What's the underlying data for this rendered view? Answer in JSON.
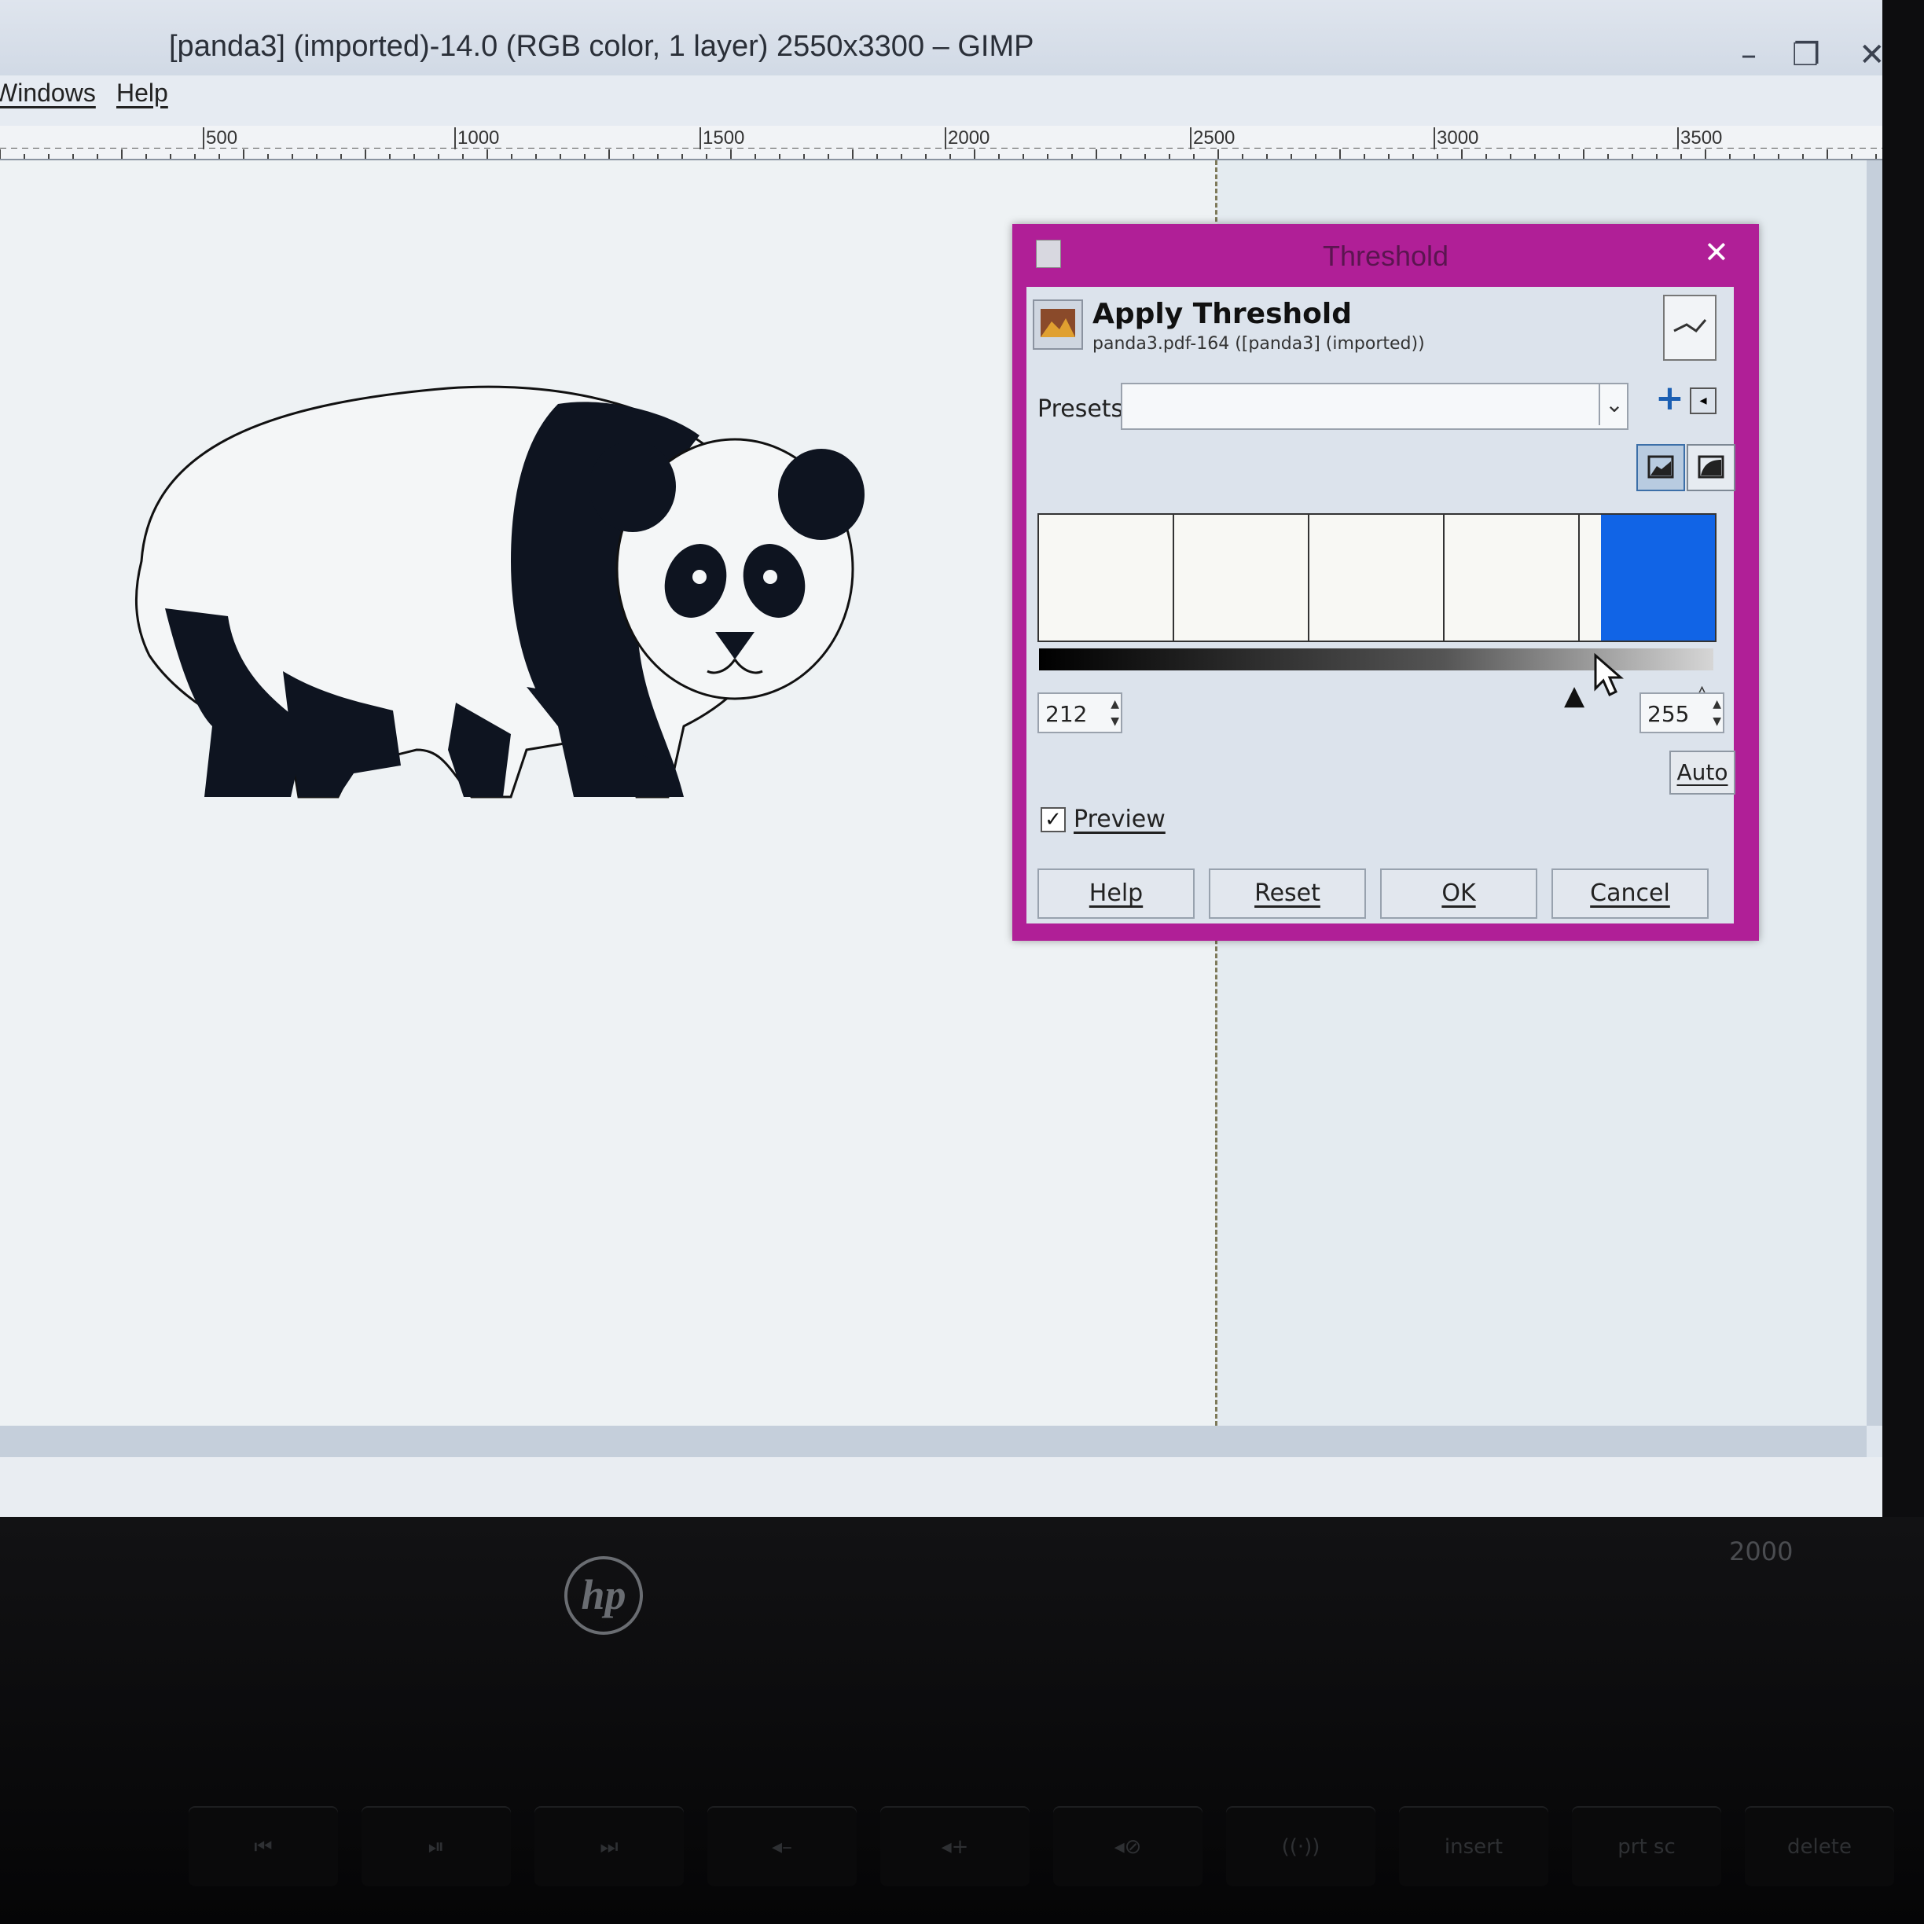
{
  "window": {
    "title": "[panda3] (imported)-14.0 (RGB color, 1 layer) 2550x3300 – GIMP",
    "minimize": "–",
    "maximize": "❐",
    "close": "✕"
  },
  "menu": {
    "windows": "Windows",
    "help": "Help"
  },
  "ruler": {
    "labels": [
      "500",
      "1000",
      "1500",
      "2000",
      "2500",
      "3000",
      "3500"
    ]
  },
  "dialog": {
    "title": "Threshold",
    "close": "✕",
    "header_title": "Apply Threshold",
    "header_subtitle": "panda3.pdf-164 ([panda3] (imported))",
    "presets_label": "Presets:",
    "presets_value": "",
    "presets_add": "+",
    "threshold_low": "212",
    "threshold_high": "255",
    "auto_label": "Auto",
    "preview_label": "Preview",
    "preview_checked": "✓",
    "buttons": {
      "help": "Help",
      "reset": "Reset",
      "ok": "OK",
      "cancel": "Cancel"
    },
    "range_color": "#1164e6"
  },
  "laptop": {
    "brand": "hp",
    "model": "2000"
  },
  "keyboard": {
    "keys": [
      "⏮",
      "⏯",
      "⏭",
      "◂–",
      "◂+",
      "◂⊘",
      "((·))",
      "insert",
      "prt sc",
      "delete"
    ]
  }
}
